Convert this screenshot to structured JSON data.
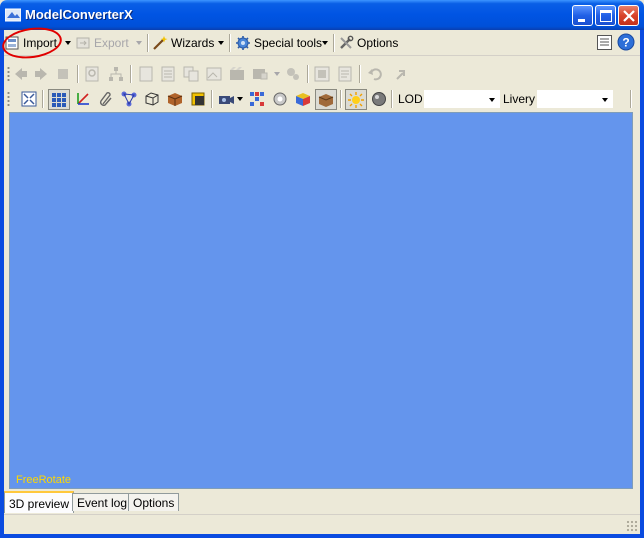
{
  "window": {
    "title": "ModelConverterX",
    "controls": [
      "minimize-icon",
      "maximize-icon",
      "close-icon"
    ]
  },
  "menu": {
    "import_label": "Import",
    "export_label": "Export",
    "wizards_label": "Wizards",
    "special_tools_label": "Special tools",
    "options_label": "Options"
  },
  "toolbar": {
    "lod_label": "LOD",
    "livery_label": "Livery",
    "lod_value": "",
    "livery_value": ""
  },
  "viewport": {
    "mode_label": "FreeRotate",
    "background_color": "#6495ED",
    "mode_color": "#FFD800"
  },
  "tabs": [
    {
      "label": "3D preview",
      "active": true
    },
    {
      "label": "Event log",
      "active": false
    },
    {
      "label": "Options",
      "active": false
    }
  ],
  "annotation": {
    "color": "#E00000",
    "target": "import-button"
  }
}
